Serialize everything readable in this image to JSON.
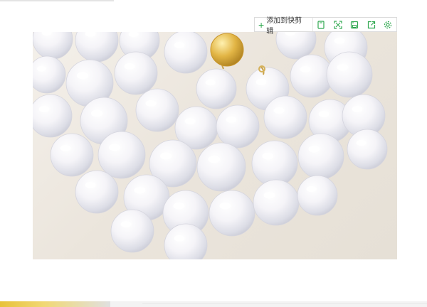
{
  "toolbar": {
    "add_label": "添加到快剪辑",
    "buttons": [
      {
        "name": "window-icon"
      },
      {
        "name": "fullscreen-icon"
      },
      {
        "name": "save-icon"
      },
      {
        "name": "share-icon"
      },
      {
        "name": "settings-icon"
      }
    ]
  },
  "colors": {
    "accent": "#2fa84f",
    "pearl": "#f7f7fb",
    "clasp": "#d9a93a",
    "background": "#ece6dd"
  }
}
